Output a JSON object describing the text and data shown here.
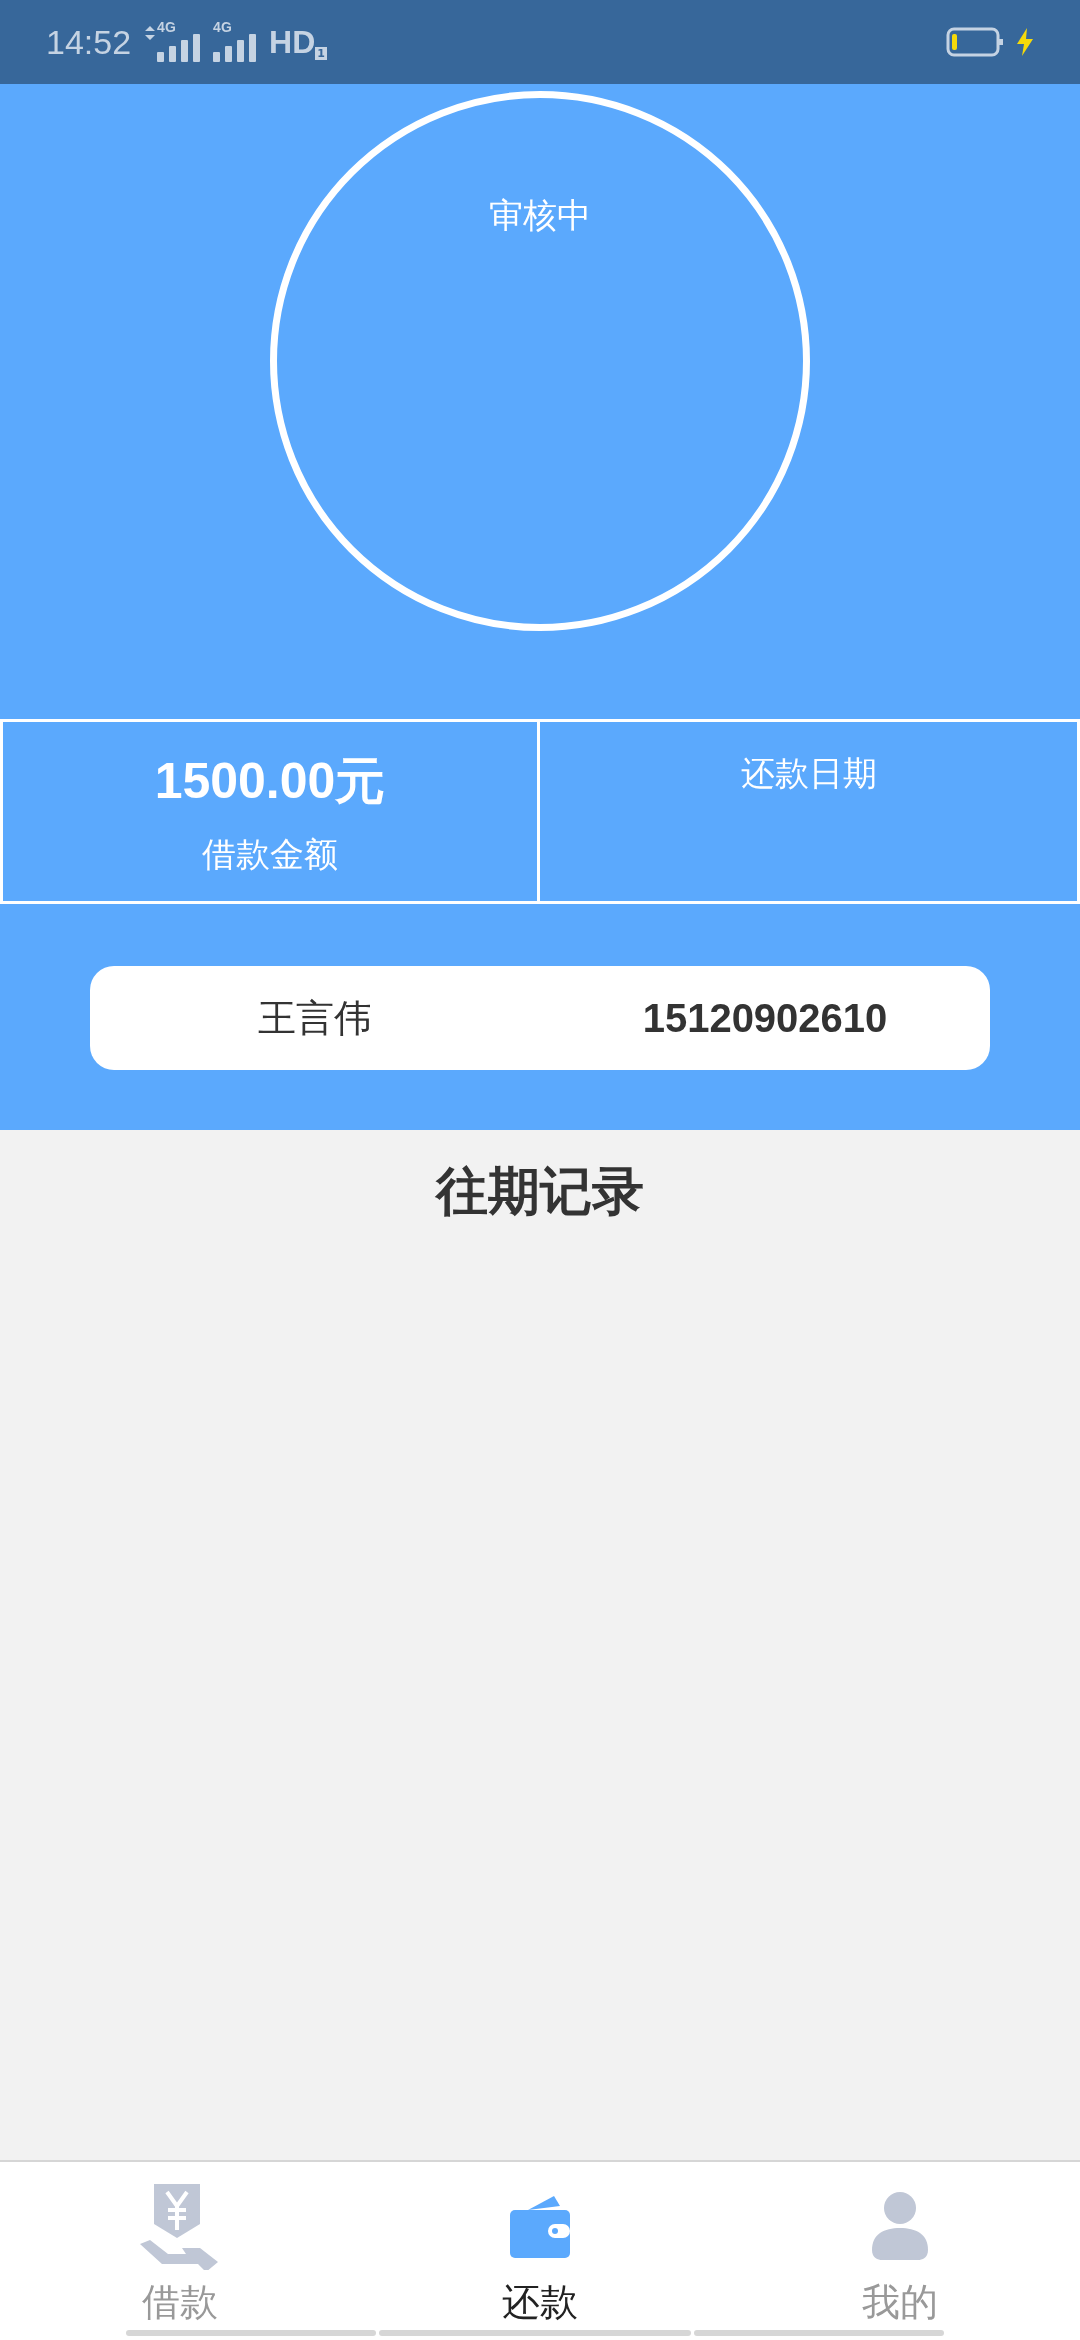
{
  "status_bar": {
    "time": "14:52",
    "network_1": "4G",
    "network_2": "4G",
    "hd": "HD",
    "sim": "1"
  },
  "status": {
    "label": "审核中"
  },
  "summary": [
    {
      "value": "1500.00元",
      "label": "借款金额"
    },
    {
      "label": "还款日期"
    }
  ],
  "borrower": {
    "name": "王言伟",
    "phone": "15120902610"
  },
  "records": {
    "title": "往期记录"
  },
  "tabs": [
    {
      "label": "借款",
      "kind": "loan",
      "selected": false
    },
    {
      "label": "还款",
      "kind": "repay",
      "selected": true
    },
    {
      "label": "我的",
      "kind": "me",
      "selected": false
    }
  ]
}
